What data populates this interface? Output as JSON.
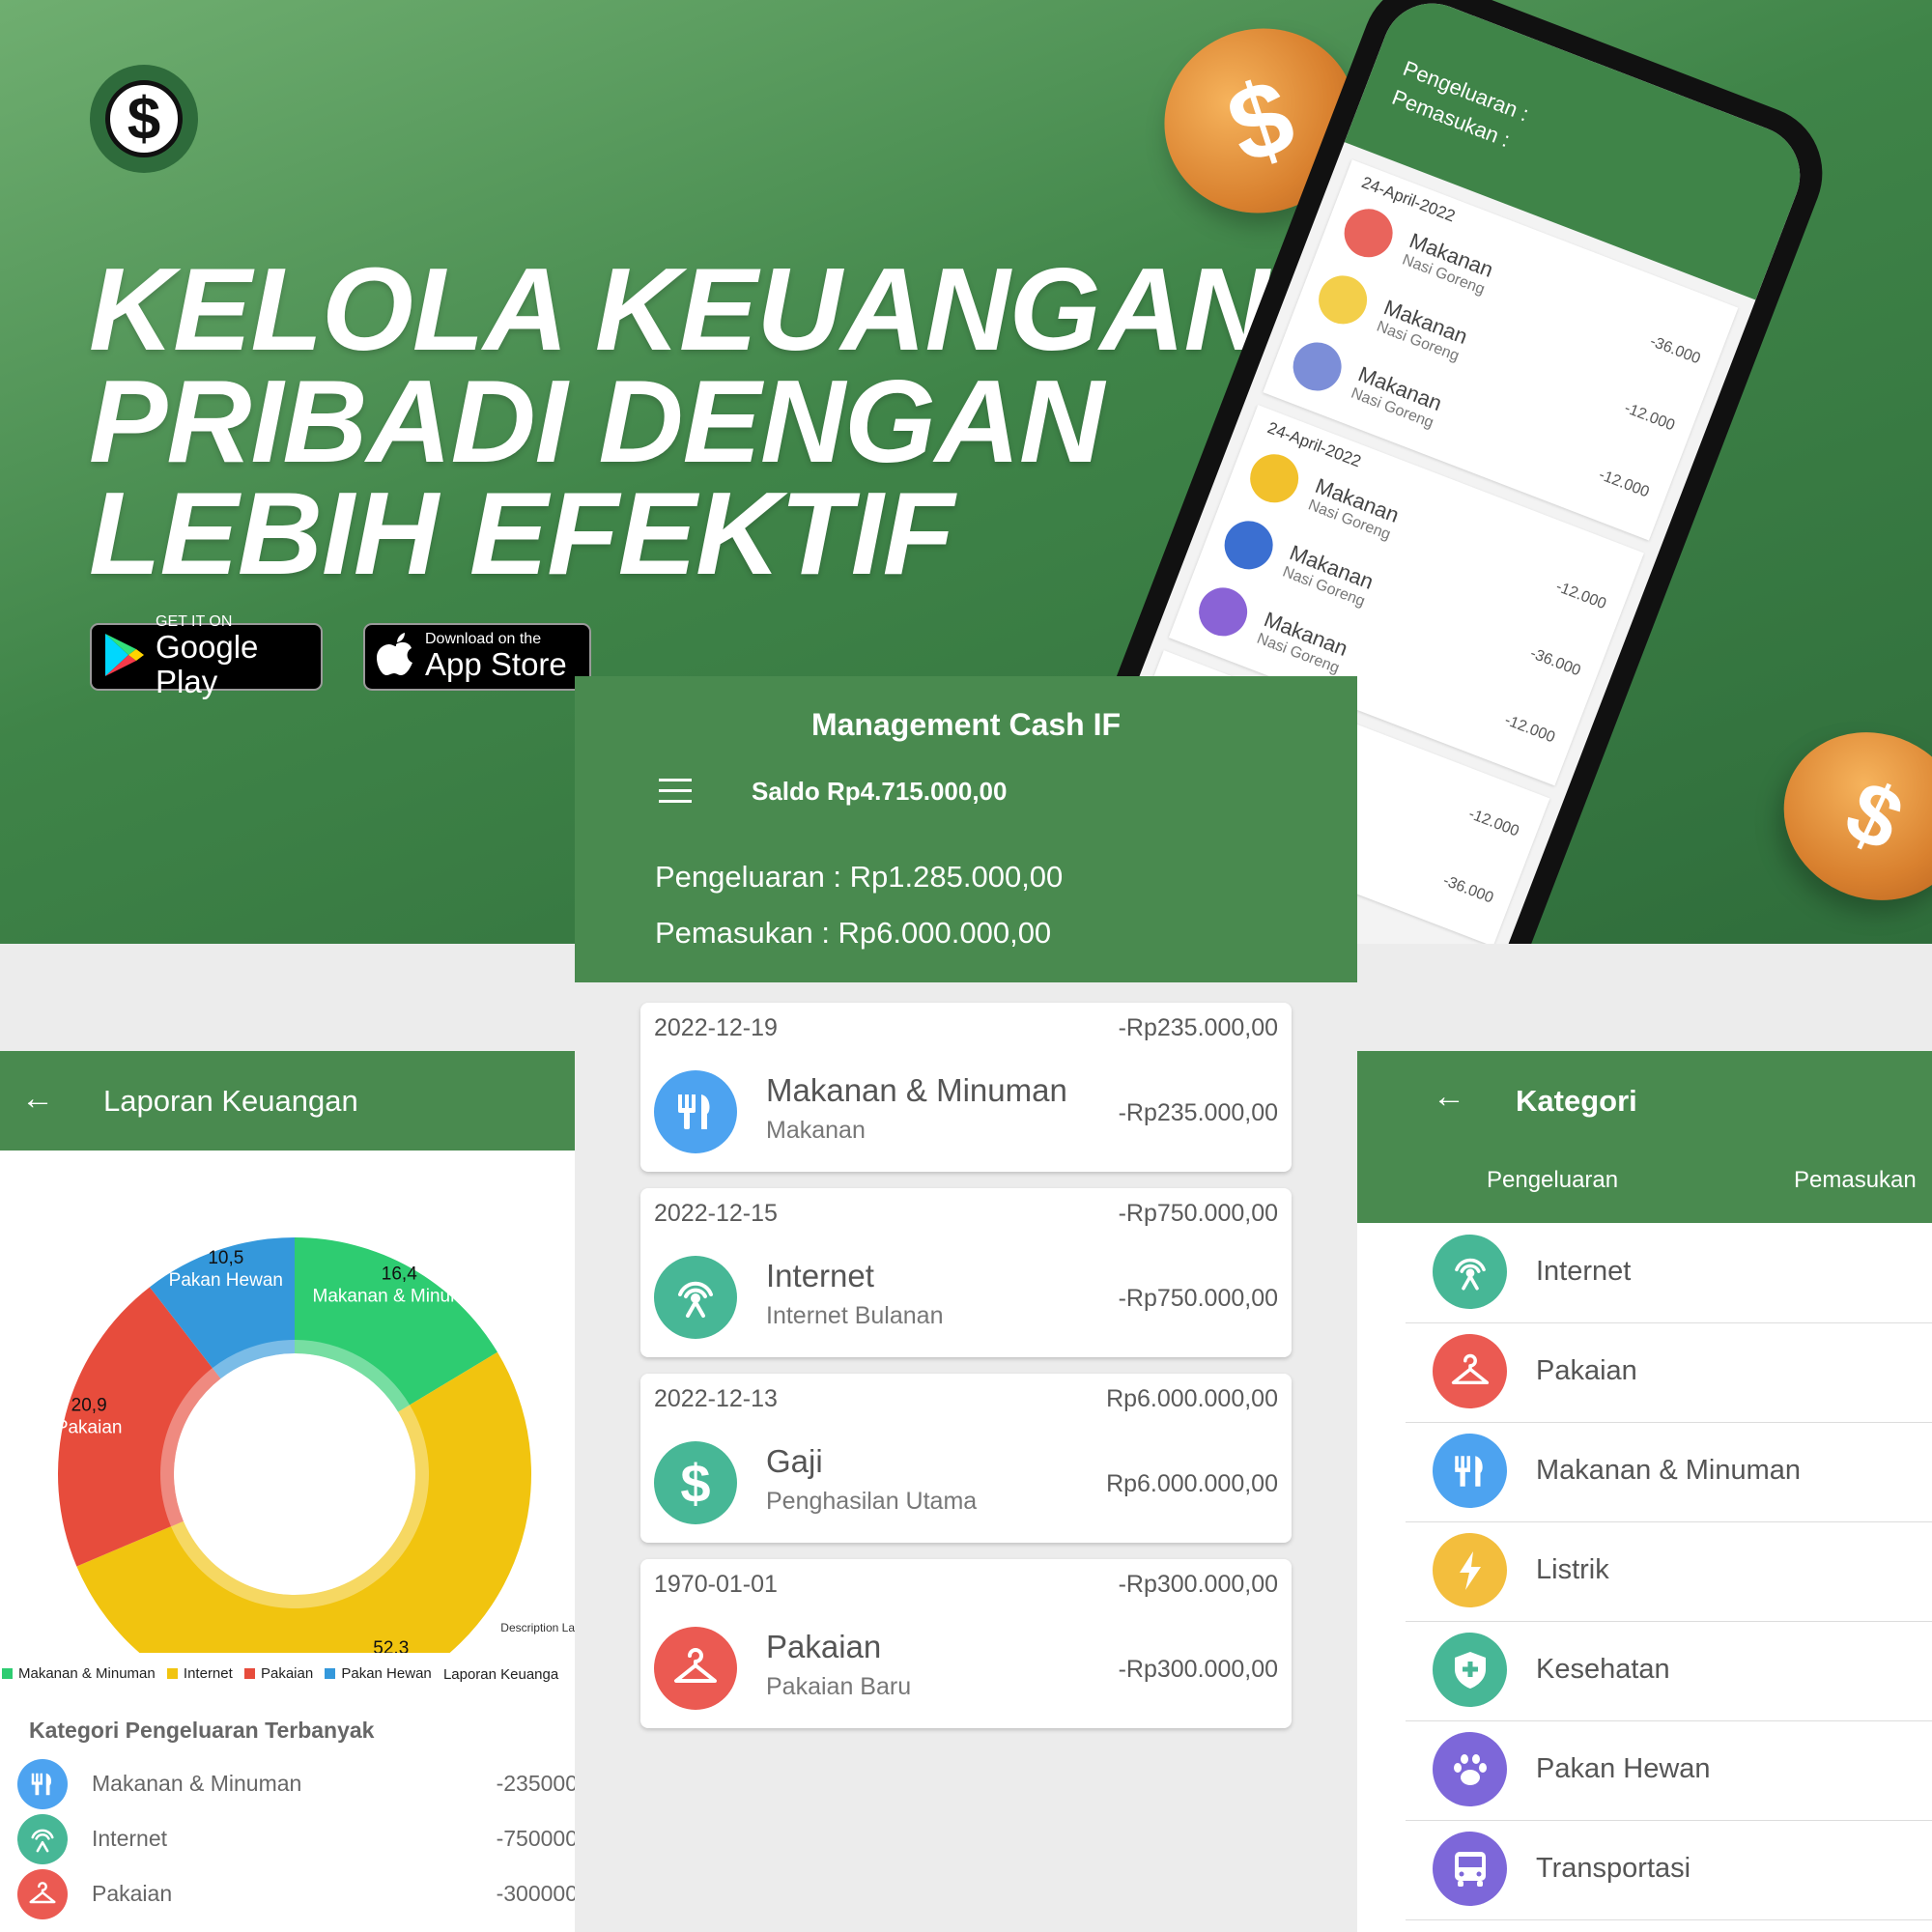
{
  "colors": {
    "primary_green": "#498a4f",
    "food_blue": "#4da3f0",
    "internet_teal": "#47b796",
    "clothing_red": "#eb5a52",
    "electric_yellow": "#f3be3d",
    "pet_purple": "#7d67d9",
    "chart_green": "#2ecc71",
    "chart_yellow": "#f1c40f",
    "chart_red": "#e74c3c",
    "chart_blue": "#3498db"
  },
  "banner": {
    "headline_line1": "KELOLA KEUANGAN",
    "headline_line2": "PRIBADI DENGAN",
    "headline_line3": "LEBIH EFEKTIF",
    "google_small": "GET IT ON",
    "google_big": "Google Play",
    "apple_small": "Download on the",
    "apple_big": "App Store"
  },
  "phone": {
    "pengeluaran": "Pengeluaran :",
    "pemasukan": "Pemasukan :",
    "groups": [
      {
        "date": "24-April-2022",
        "items": [
          {
            "title": "Makanan",
            "sub": "Nasi Goreng",
            "amount": "-36.000",
            "avatar": "#e9645c"
          },
          {
            "title": "Makanan",
            "sub": "Nasi Goreng",
            "amount": "-12.000",
            "avatar": "#f3cf4a"
          },
          {
            "title": "Makanan",
            "sub": "Nasi Goreng",
            "amount": "-12.000",
            "avatar": "#7c8ed8"
          }
        ]
      },
      {
        "date": "24-April-2022",
        "items": [
          {
            "title": "Makanan",
            "sub": "Nasi Goreng",
            "amount": "-12.000",
            "avatar": "#f2c12c"
          },
          {
            "title": "Makanan",
            "sub": "Nasi Goreng",
            "amount": "-36.000",
            "avatar": "#3b6fd1"
          },
          {
            "title": "Makanan",
            "sub": "Nasi Goreng",
            "amount": "-12.000",
            "avatar": "#8a63d6"
          }
        ]
      },
      {
        "date": "",
        "items": [
          {
            "title": "Makanan",
            "sub": "Nasi Goreng",
            "amount": "-12.000",
            "avatar": "#cccccc"
          },
          {
            "title": "Makanan",
            "sub": "Nasi Goreng",
            "amount": "-36.000",
            "avatar": "#cccccc"
          }
        ]
      }
    ]
  },
  "main": {
    "title": "Management Cash IF",
    "saldo": "Saldo Rp4.715.000,00",
    "pengeluaran": "Pengeluaran : Rp1.285.000,00",
    "pemasukan": "Pemasukan : Rp6.000.000,00",
    "transactions": [
      {
        "date": "2022-12-19",
        "top_amount": "-Rp235.000,00",
        "title": "Makanan & Minuman",
        "sub": "Makanan",
        "amount": "-Rp235.000,00",
        "icon": "fork-knife-icon",
        "color": "#4da3f0"
      },
      {
        "date": "2022-12-15",
        "top_amount": "-Rp750.000,00",
        "title": "Internet",
        "sub": "Internet Bulanan",
        "amount": "-Rp750.000,00",
        "icon": "antenna-icon",
        "color": "#47b796"
      },
      {
        "date": "2022-12-13",
        "top_amount": "Rp6.000.000,00",
        "title": "Gaji",
        "sub": "Penghasilan Utama",
        "amount": "Rp6.000.000,00",
        "icon": "dollar-icon",
        "color": "#47b796"
      },
      {
        "date": "1970-01-01",
        "top_amount": "-Rp300.000,00",
        "title": "Pakaian",
        "sub": "Pakaian Baru",
        "amount": "-Rp300.000,00",
        "icon": "hanger-icon",
        "color": "#eb5a52"
      }
    ]
  },
  "report": {
    "title": "Laporan Keuangan",
    "description": "Description La",
    "legend_extra": "Laporan Keuanga",
    "top_title": "Kategori Pengeluaran Terbanyak",
    "top_items": [
      {
        "label": "Makanan & Minuman",
        "value": "-235000",
        "icon": "fork-knife-icon",
        "color": "#4da3f0"
      },
      {
        "label": "Internet",
        "value": "-750000",
        "icon": "antenna-icon",
        "color": "#47b796"
      },
      {
        "label": "Pakaian",
        "value": "-300000",
        "icon": "hanger-icon",
        "color": "#eb5a52"
      }
    ]
  },
  "chart_data": {
    "type": "pie",
    "categories": [
      "Makanan & Minuman",
      "Internet",
      "Pakaian",
      "Pakan Hewan"
    ],
    "values": [
      16.4,
      52.3,
      20.9,
      10.5
    ],
    "value_labels": [
      "16,4",
      "52,3",
      "20,9",
      "10,5"
    ],
    "colors": [
      "#2ecc71",
      "#f1c40f",
      "#e74c3c",
      "#3498db"
    ],
    "legend": "bottom-left"
  },
  "kategori": {
    "title": "Kategori",
    "tab_pengeluaran": "Pengeluaran",
    "tab_pemasukan": "Pemasukan",
    "items": [
      {
        "label": "Internet",
        "icon": "antenna-icon",
        "color": "#47b796"
      },
      {
        "label": "Pakaian",
        "icon": "hanger-icon",
        "color": "#eb5a52"
      },
      {
        "label": "Makanan & Minuman",
        "icon": "fork-knife-icon",
        "color": "#4da3f0"
      },
      {
        "label": "Listrik",
        "icon": "lightning-icon",
        "color": "#f3be3d"
      },
      {
        "label": "Kesehatan",
        "icon": "shield-plus-icon",
        "color": "#47b796"
      },
      {
        "label": "Pakan Hewan",
        "icon": "paw-icon",
        "color": "#7d67d9"
      },
      {
        "label": "Transportasi",
        "icon": "bus-icon",
        "color": "#7d67d9"
      }
    ]
  }
}
